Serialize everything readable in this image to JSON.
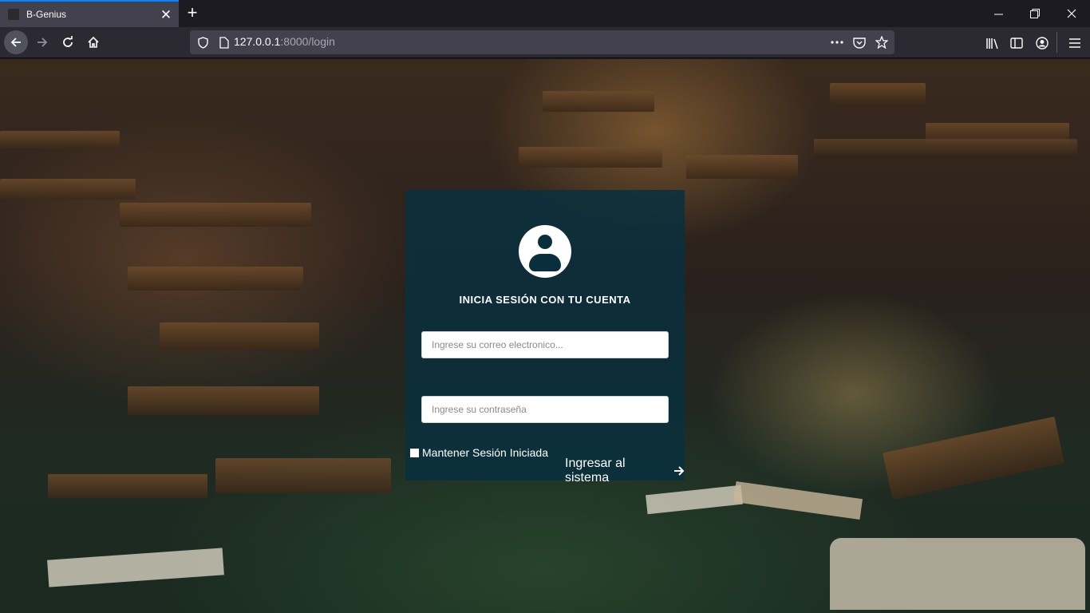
{
  "browser": {
    "tab": {
      "title": "B-Genius"
    },
    "address": {
      "host": "127.0.0.1",
      "rest": ":8000/login"
    }
  },
  "colors": {
    "card_bg": "#09303e",
    "accent": "#0a84ff",
    "text": "#ffffff"
  },
  "login": {
    "heading": "INICIA SESIÓN CON TU CUENTA",
    "email_placeholder": "Ingrese su correo electronico...",
    "password_placeholder": "Ingrese su contraseña",
    "remember_label": "Mantener Sesión Iniciada",
    "submit_label": "Ingresar al sistema"
  },
  "icons": [
    "back-arrow-icon",
    "forward-arrow-icon",
    "reload-icon",
    "home-icon",
    "shield-icon",
    "page-icon",
    "more-icon",
    "pocket-icon",
    "star-icon",
    "library-icon",
    "sidebar-icon",
    "account-icon",
    "menu-icon",
    "user-avatar-icon",
    "arrow-right-icon"
  ]
}
